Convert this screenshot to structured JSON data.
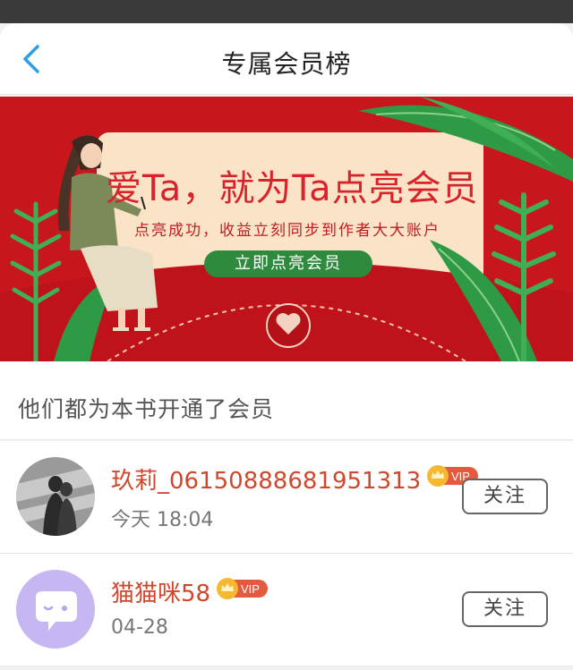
{
  "header": {
    "title": "专属会员榜",
    "back_icon": "chevron-left-icon"
  },
  "banner": {
    "headline": "爱Ta，就为Ta点亮会员",
    "subtext": "点亮成功，收益立刻同步到作者大大账户",
    "cta_label": "立即点亮会员",
    "colors": {
      "background": "#c8161d",
      "card": "#fbe3c8",
      "cta": "#2e8b3e"
    }
  },
  "section": {
    "title": "他们都为本书开通了会员"
  },
  "members": [
    {
      "name": "玖莉_0615088868195131​3",
      "time": "今天 18:04",
      "vip_label": "VIP",
      "follow_label": "关注",
      "avatar": "photo-avatar"
    },
    {
      "name": "猫猫咪58",
      "time": "04-28",
      "vip_label": "VIP",
      "follow_label": "关注",
      "avatar": "chat-bubble-avatar"
    }
  ]
}
